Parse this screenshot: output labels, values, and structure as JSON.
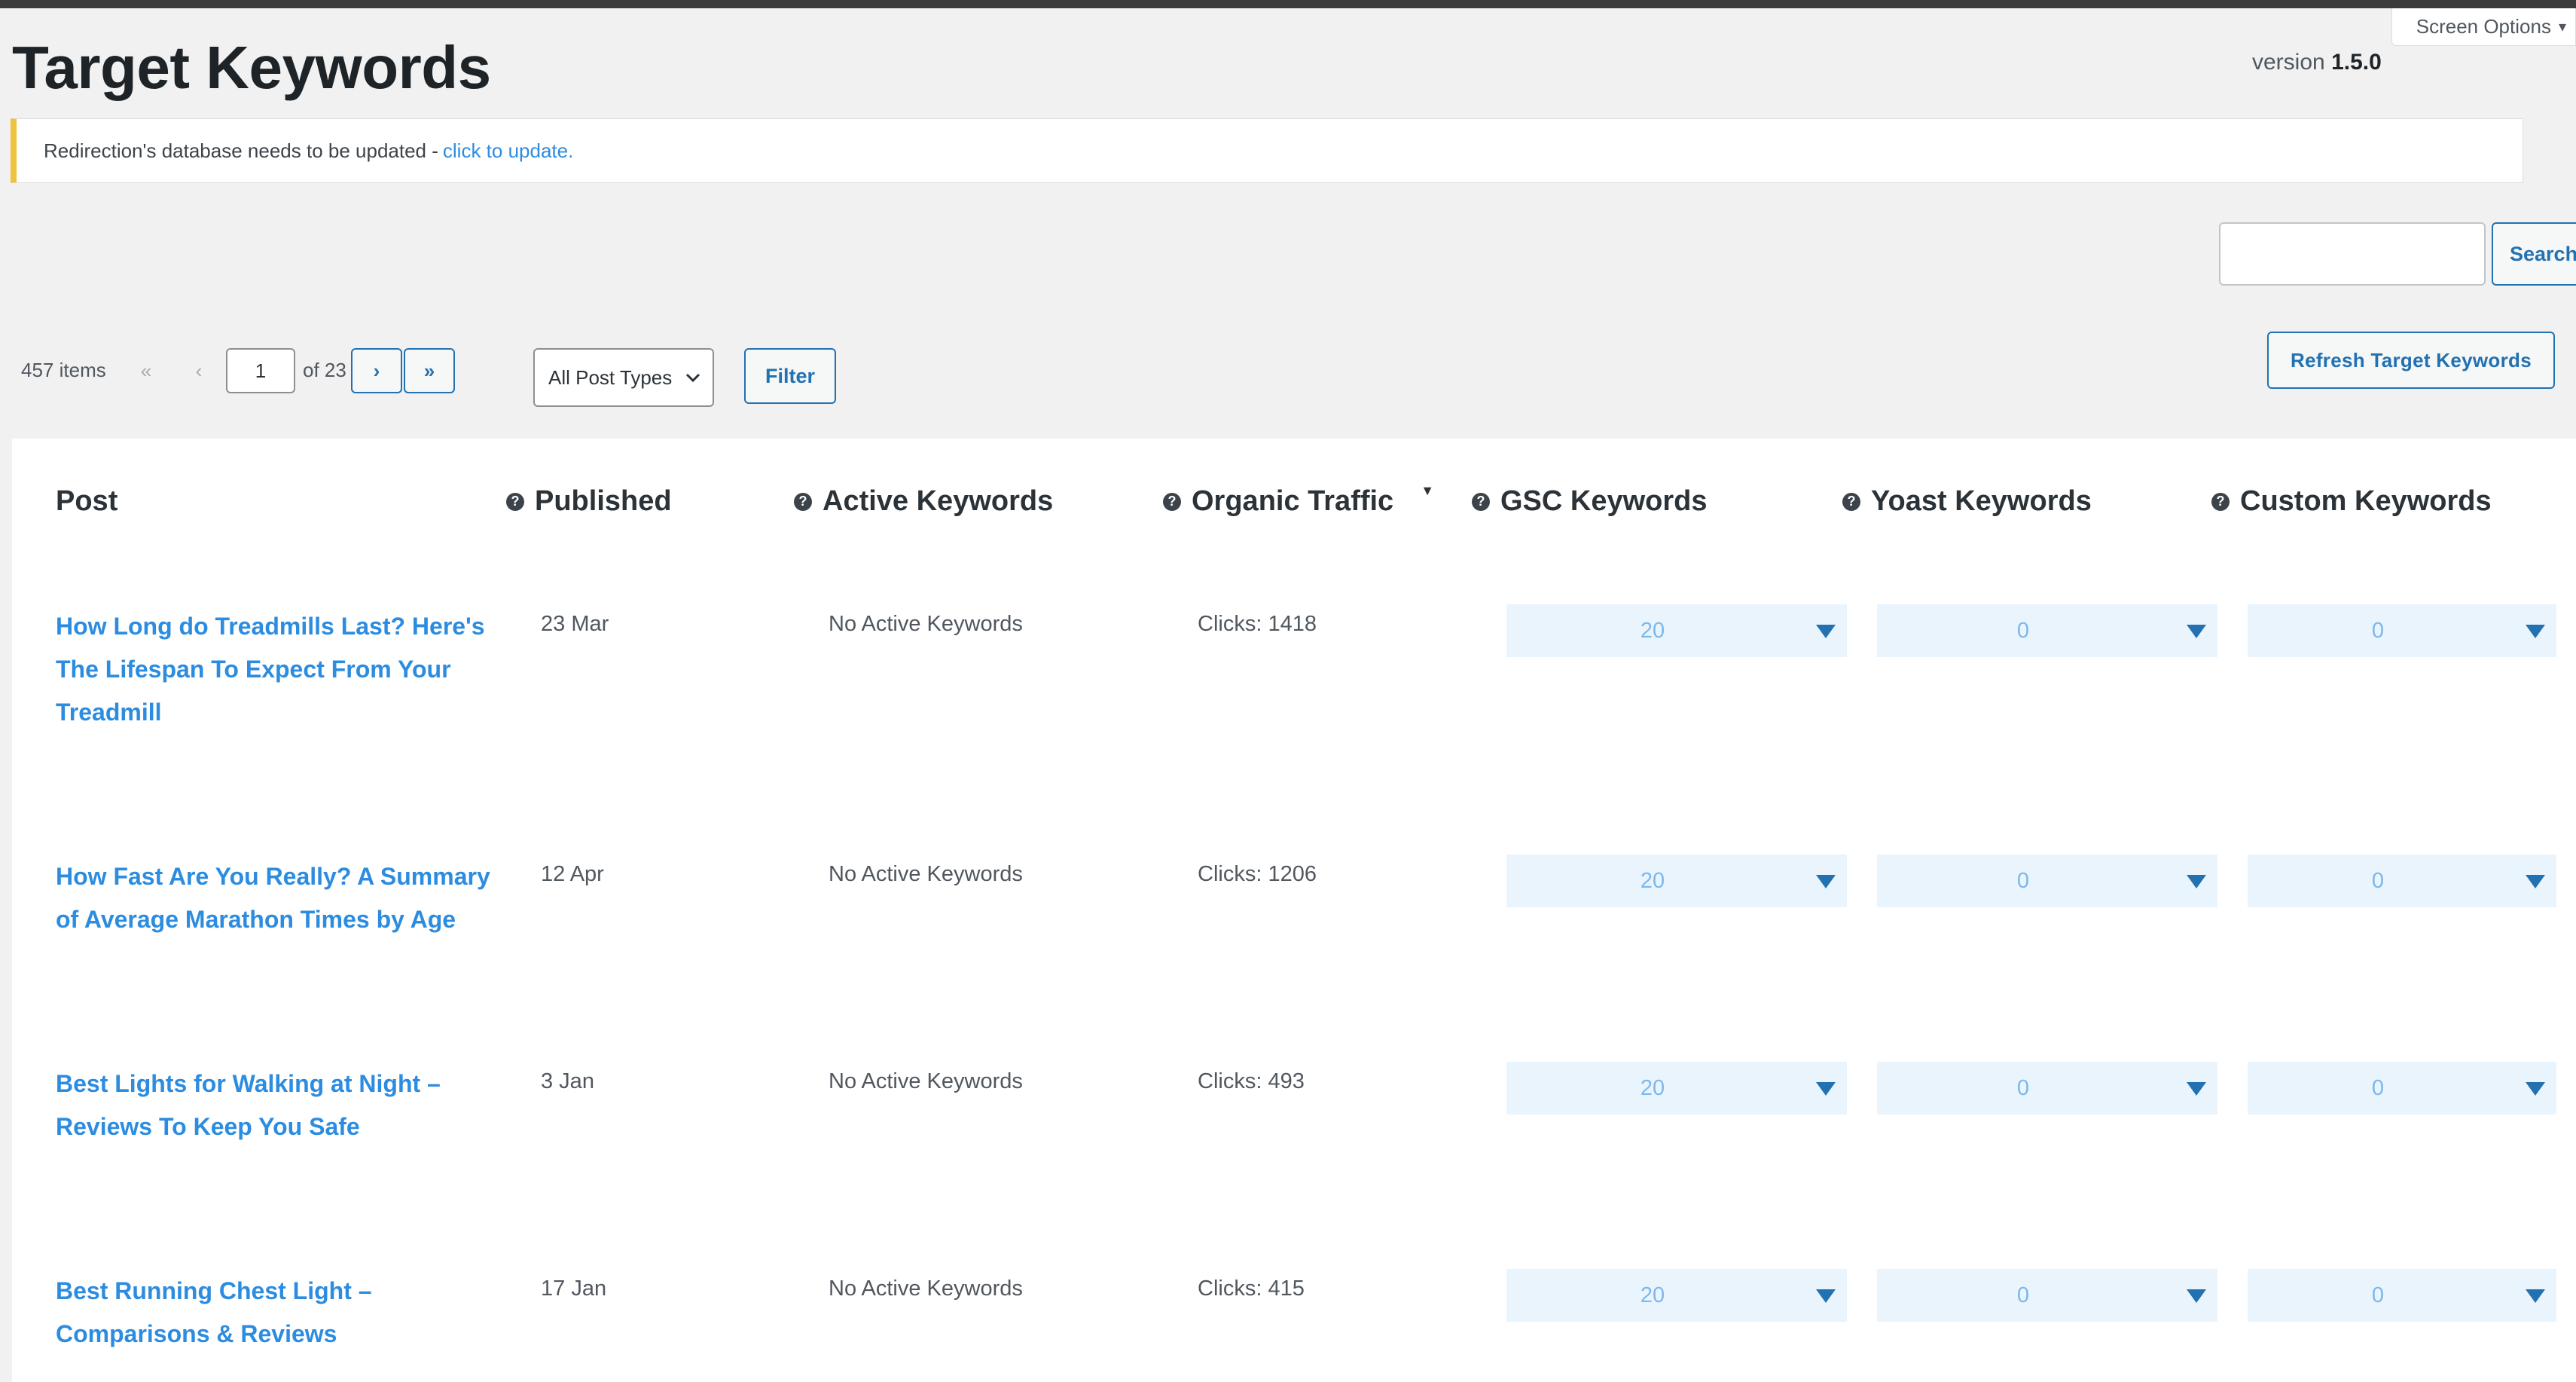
{
  "screen_options": "Screen Options",
  "page_title": "Target Keywords",
  "version": {
    "label": "version",
    "number": "1.5.0"
  },
  "notice": {
    "text": "Redirection's database needs to be updated -",
    "link": "click to update."
  },
  "search": {
    "button": "Search"
  },
  "pagination": {
    "items": "457 items",
    "first": "«",
    "prev": "‹",
    "current_page": "1",
    "of_total": "of 23",
    "next": "›",
    "last": "»"
  },
  "filters": {
    "post_types": "All Post Types",
    "filter_button": "Filter"
  },
  "refresh_button": "Refresh Target Keywords",
  "table": {
    "columns": {
      "post": "Post",
      "published": "Published",
      "active_keywords": "Active Keywords",
      "organic_traffic": "Organic Traffic",
      "gsc_keywords": "GSC Keywords",
      "yoast_keywords": "Yoast Keywords",
      "custom_keywords": "Custom Keywords"
    },
    "rows": [
      {
        "title": "How Long do Treadmills Last? Here's The Lifespan To Expect From Your Treadmill",
        "published": "23 Mar",
        "active": "No Active Keywords",
        "traffic": "Clicks: 1418",
        "gsc": "20",
        "yoast": "0",
        "custom": "0"
      },
      {
        "title": "How Fast Are You Really? A Summary of Average Marathon Times by Age",
        "published": "12 Apr",
        "active": "No Active Keywords",
        "traffic": "Clicks: 1206",
        "gsc": "20",
        "yoast": "0",
        "custom": "0"
      },
      {
        "title": "Best Lights for Walking at Night – Reviews To Keep You Safe",
        "published": "3 Jan",
        "active": "No Active Keywords",
        "traffic": "Clicks: 493",
        "gsc": "20",
        "yoast": "0",
        "custom": "0"
      },
      {
        "title": "Best Running Chest Light – Comparisons & Reviews",
        "published": "17 Jan",
        "active": "No Active Keywords",
        "traffic": "Clicks: 415",
        "gsc": "20",
        "yoast": "0",
        "custom": "0"
      }
    ]
  },
  "colors": {
    "accent": "#2271b1",
    "link": "#2c8ce0",
    "notice_border": "#f0c33c",
    "dropdown_bg": "#eaf4fd"
  }
}
